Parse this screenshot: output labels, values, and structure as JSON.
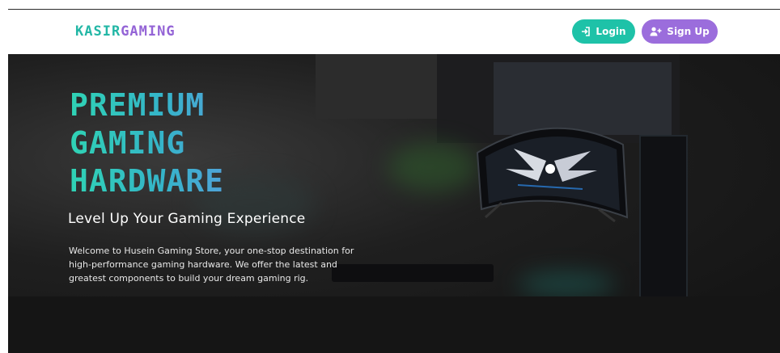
{
  "brand": {
    "part1": "KASIR",
    "part2": "GAMING"
  },
  "nav": {
    "login_label": "Login",
    "signup_label": "Sign Up"
  },
  "hero": {
    "title_lines": [
      "PREMIUM",
      "GAMING",
      "HARDWARE"
    ],
    "subtitle": "Level Up Your Gaming Experience",
    "description": "Welcome to Husein Gaming Store, your one-stop destination for high-performance gaming hardware. We offer the latest and greatest components to build your dream gaming rig."
  },
  "colors": {
    "brand_teal": "#23b7a6",
    "brand_purple": "#9464d6",
    "login_button": "#1ec2a8",
    "signup_button": "#9b6ddc"
  },
  "icons": {
    "login": "login-icon",
    "signup": "add-user-icon"
  }
}
